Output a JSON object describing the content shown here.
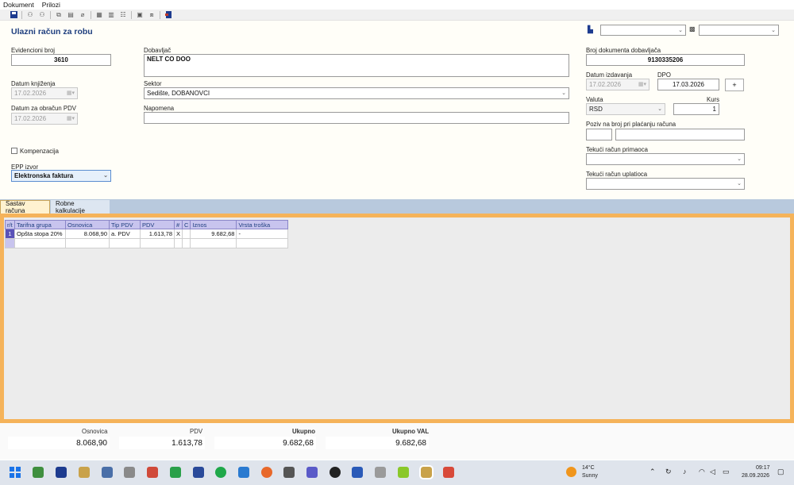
{
  "menu": {
    "items": [
      "Dokument",
      "Prilozi"
    ]
  },
  "toolbar": {
    "icons": [
      "save-icon",
      "add-icon",
      "edit-icon",
      "tree-icon",
      "attach-icon",
      "copy-icon",
      "grid-icon",
      "list-icon",
      "disk-icon",
      "export-icon",
      "close-icon"
    ]
  },
  "title": "Ulazni račun za robu",
  "fields": {
    "evidencioni_broj": {
      "label": "Evidencioni broj",
      "value": "3610"
    },
    "dobavljac": {
      "label": "Dobavljač",
      "value": "NELT CO DOO"
    },
    "datum_knjizenja": {
      "label": "Datum knjiženja",
      "value": "17.02.2026"
    },
    "sektor": {
      "label": "Sektor",
      "value": "Sedište, DOBANOVCI"
    },
    "datum_obracun_pdv": {
      "label": "Datum za obračun PDV",
      "value": "17.02.2026"
    },
    "napomena": {
      "label": "Napomena",
      "value": ""
    },
    "kompenzacija": {
      "label": "Kompenzacija",
      "checked": false
    },
    "epp_izvor": {
      "label": "EPP izvor",
      "value": "Elektronska faktura"
    },
    "broj_dokumenta": {
      "label": "Broj dokumenta dobavljača",
      "value": "9130335206"
    },
    "datum_izdavanja": {
      "label": "Datum izdavanja",
      "value": "17.02.2026"
    },
    "dpo": {
      "label": "DPO",
      "value": "17.03.2026"
    },
    "plus_label": "+",
    "valuta": {
      "label": "Valuta",
      "value": "RSD"
    },
    "kurs": {
      "label": "Kurs",
      "value": "1"
    },
    "poziv": {
      "label": "Poziv na broj pri plaćanju računa",
      "value": ""
    },
    "tekuci_primaoca": {
      "label": "Tekući račun primaoca",
      "value": ""
    },
    "tekuci_uplatioca": {
      "label": "Tekući račun uplatioca",
      "value": ""
    }
  },
  "tabs": [
    {
      "label": "Sastav računa",
      "active": true
    },
    {
      "label": "Robne kalkulacije",
      "active": false
    }
  ],
  "grid": {
    "columns": [
      "r/t",
      "Tarifna grupa",
      "Osnovica",
      "Tip PDV",
      "PDV",
      "#",
      "C",
      "Iznos",
      "Vrsta troška"
    ],
    "rows": [
      {
        "rn": "1",
        "tarifna_grupa": "Opšta stopa 20%",
        "osnovica": "8.068,90",
        "tip_pdv": "a. PDV",
        "pdv": "1.613,78",
        "hash": "X",
        "c": "",
        "iznos": "9.682,68",
        "vrsta_troska": "-"
      }
    ]
  },
  "totals": {
    "osnovica": {
      "label": "Osnovica",
      "value": "8.068,90"
    },
    "pdv": {
      "label": "PDV",
      "value": "1.613,78"
    },
    "ukupno": {
      "label": "Ukupno",
      "value": "9.682,68"
    },
    "ukupno_val": {
      "label": "Ukupno VAL",
      "value": "9.682,68"
    }
  },
  "taskbar": {
    "weather_temp": "14°C",
    "weather_desc": "Sunny",
    "time": "09:17",
    "date": "28.09.2026"
  },
  "colors": {
    "title": "#1f3f7f",
    "grid_frame": "#f5b35a",
    "grid_header": "#c8c4ee",
    "tabs_bar": "#b8c9dd"
  }
}
